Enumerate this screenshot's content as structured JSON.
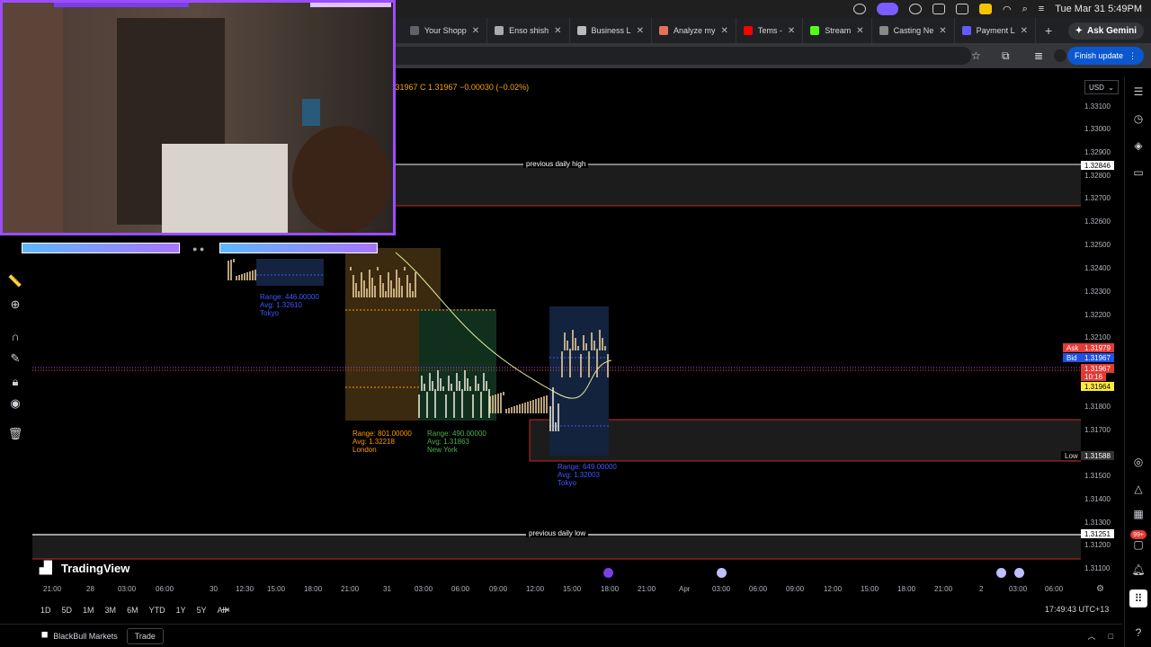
{
  "menubar": {
    "datetime": "Tue Mar 31  5:49PM"
  },
  "tabs": [
    {
      "label": "Your Shopp",
      "color": "#5f6368"
    },
    {
      "label": "Enso shish",
      "color": "#aaaaaa"
    },
    {
      "label": "Business L",
      "color": "#bbbbbb"
    },
    {
      "label": "Analyze my",
      "color": "#e2725b"
    },
    {
      "label": "Tems -",
      "color": "#ff0000"
    },
    {
      "label": "Stream",
      "color": "#53fc18"
    },
    {
      "label": "Casting Ne",
      "color": "#888888"
    },
    {
      "label": "Payment L",
      "color": "#635bff"
    }
  ],
  "browser": {
    "ask_gemini": "Ask Gemini",
    "finish_update": "Finish update"
  },
  "chart": {
    "ohlc": "1.31967  C 1.31967  −0.00030 (−0.02%)",
    "currency": "USD",
    "price_levels": [
      "1.33100",
      "1.33000",
      "1.32900",
      "1.32800",
      "1.32700",
      "1.32600",
      "1.32500",
      "1.32400",
      "1.32300",
      "1.32200",
      "1.32100",
      "1.31800",
      "1.31700",
      "1.31500",
      "1.31400",
      "1.31300",
      "1.31200",
      "1.31100"
    ],
    "tags": {
      "prev_high": "1.32846",
      "ask_label": "Ask",
      "ask": "1.31979",
      "bid_label": "Bid",
      "bid": "1.31967",
      "last": "1.31967",
      "countdown": "10:16",
      "yellow": "1.31964",
      "low_label": "Low",
      "low": "1.31588",
      "prev_low": "1.31251"
    },
    "previous_daily_high": "previous daily high",
    "previous_daily_low": "previous daily low",
    "sessions": [
      {
        "range": "Range: 446.00000",
        "avg": "Avg: 1.32610",
        "name": "Tokyo",
        "color": "#3d5afe"
      },
      {
        "range": "Range: 801.00000",
        "avg": "Avg: 1.32218",
        "name": "London",
        "color": "#ff9800"
      },
      {
        "range": "Range: 490.00000",
        "avg": "Avg: 1.31863",
        "name": "New York",
        "color": "#4caf50"
      },
      {
        "range": "Range: 649.00000",
        "avg": "Avg: 1.32003",
        "name": "Tokyo",
        "color": "#3d5afe"
      }
    ],
    "time_labels": [
      "21:00",
      "28",
      "03:00",
      "06:00",
      "30",
      "12:30",
      "15:00",
      "18:00",
      "21:00",
      "31",
      "03:00",
      "06:00",
      "09:00",
      "12:00",
      "15:00",
      "18:00",
      "21:00",
      "Apr",
      "03:00",
      "06:00",
      "09:00",
      "12:00",
      "15:00",
      "18:00",
      "21:00",
      "2",
      "03:00",
      "06:00"
    ]
  },
  "logo": "TradingView",
  "ranges": [
    "1D",
    "5D",
    "1M",
    "3M",
    "6M",
    "YTD",
    "1Y",
    "5Y",
    "All"
  ],
  "clock": "17:49:43 UTC+13",
  "broker": {
    "name": "BlackBull Markets",
    "trade": "Trade"
  },
  "rightbar": {
    "badge": "99+"
  }
}
